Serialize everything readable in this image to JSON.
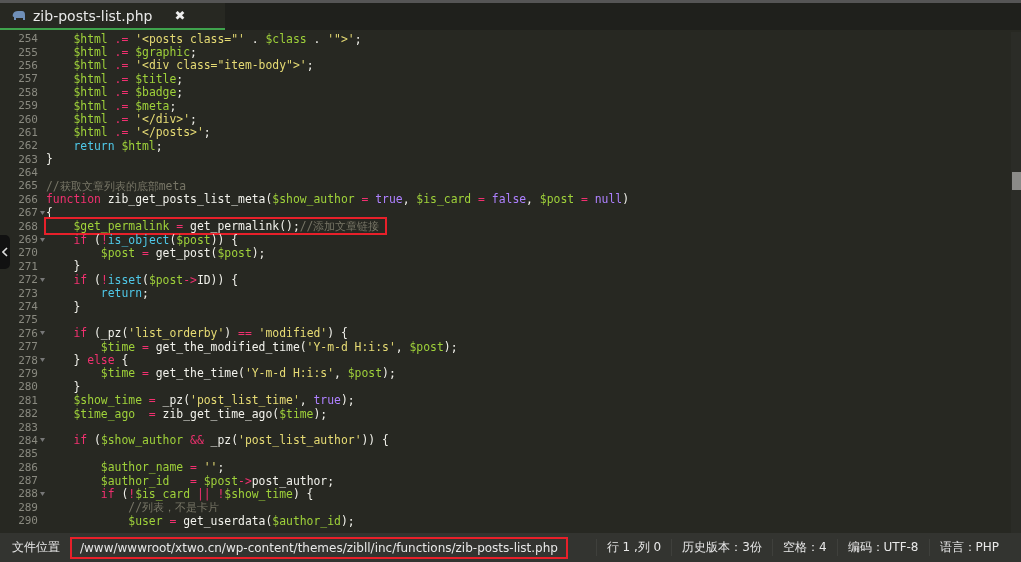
{
  "tabs": [
    {
      "title": "zib-posts-list.php",
      "close": "✖",
      "selected": true
    }
  ],
  "lines": [
    {
      "number": "254",
      "tokens": [
        {
          "kind": "variable",
          "text": "    $html"
        },
        {
          "kind": "operator",
          "text": " .= "
        },
        {
          "kind": "string",
          "text": "'<posts class=\"'"
        },
        {
          "kind": "plain",
          "text": " . "
        },
        {
          "kind": "variable",
          "text": "$class"
        },
        {
          "kind": "plain",
          "text": " . "
        },
        {
          "kind": "string",
          "text": "'\">'"
        },
        {
          "kind": "plain",
          "text": ";"
        }
      ]
    },
    {
      "number": "255",
      "tokens": [
        {
          "kind": "variable",
          "text": "    $html"
        },
        {
          "kind": "operator",
          "text": " .= "
        },
        {
          "kind": "variable",
          "text": "$graphic"
        },
        {
          "kind": "plain",
          "text": ";"
        }
      ]
    },
    {
      "number": "256",
      "tokens": [
        {
          "kind": "variable",
          "text": "    $html"
        },
        {
          "kind": "operator",
          "text": " .= "
        },
        {
          "kind": "string",
          "text": "'<div class=\"item-body\">'"
        },
        {
          "kind": "plain",
          "text": ";"
        }
      ]
    },
    {
      "number": "257",
      "tokens": [
        {
          "kind": "variable",
          "text": "    $html"
        },
        {
          "kind": "operator",
          "text": " .= "
        },
        {
          "kind": "variable",
          "text": "$title"
        },
        {
          "kind": "plain",
          "text": ";"
        }
      ]
    },
    {
      "number": "258",
      "tokens": [
        {
          "kind": "variable",
          "text": "    $html"
        },
        {
          "kind": "operator",
          "text": " .= "
        },
        {
          "kind": "variable",
          "text": "$badge"
        },
        {
          "kind": "plain",
          "text": ";"
        }
      ]
    },
    {
      "number": "259",
      "tokens": [
        {
          "kind": "variable",
          "text": "    $html"
        },
        {
          "kind": "operator",
          "text": " .= "
        },
        {
          "kind": "variable",
          "text": "$meta"
        },
        {
          "kind": "plain",
          "text": ";"
        }
      ]
    },
    {
      "number": "260",
      "tokens": [
        {
          "kind": "variable",
          "text": "    $html"
        },
        {
          "kind": "operator",
          "text": " .= "
        },
        {
          "kind": "string",
          "text": "'</div>'"
        },
        {
          "kind": "plain",
          "text": ";"
        }
      ]
    },
    {
      "number": "261",
      "tokens": [
        {
          "kind": "variable",
          "text": "    $html"
        },
        {
          "kind": "operator",
          "text": " .= "
        },
        {
          "kind": "string",
          "text": "'</posts>'"
        },
        {
          "kind": "plain",
          "text": ";"
        }
      ]
    },
    {
      "number": "262",
      "tokens": [
        {
          "kind": "builtin",
          "text": "    return "
        },
        {
          "kind": "variable",
          "text": "$html"
        },
        {
          "kind": "plain",
          "text": ";"
        }
      ]
    },
    {
      "number": "263",
      "tokens": [
        {
          "kind": "plain",
          "text": "}"
        }
      ]
    },
    {
      "number": "264"
    },
    {
      "number": "265",
      "tokens": [
        {
          "kind": "comment",
          "text": "//获取文章列表的底部meta"
        }
      ]
    },
    {
      "number": "266",
      "tokens": [
        {
          "kind": "keyword",
          "text": "function"
        },
        {
          "kind": "plain",
          "text": " zib_get_posts_list_meta("
        },
        {
          "kind": "variable",
          "text": "$show_author"
        },
        {
          "kind": "operator",
          "text": " = "
        },
        {
          "kind": "constant",
          "text": "true"
        },
        {
          "kind": "plain",
          "text": ", "
        },
        {
          "kind": "variable",
          "text": "$is_card"
        },
        {
          "kind": "operator",
          "text": " = "
        },
        {
          "kind": "constant",
          "text": "false"
        },
        {
          "kind": "plain",
          "text": ", "
        },
        {
          "kind": "variable",
          "text": "$post"
        },
        {
          "kind": "operator",
          "text": " = "
        },
        {
          "kind": "constant",
          "text": "null"
        },
        {
          "kind": "plain",
          "text": ")"
        }
      ]
    },
    {
      "number": "267",
      "foldable": true,
      "tokens": [
        {
          "kind": "plain",
          "text": "{"
        }
      ]
    },
    {
      "number": "268",
      "highlighted": true,
      "tokens": [
        {
          "kind": "variable",
          "text": "    $get_permalink"
        },
        {
          "kind": "operator",
          "text": " = "
        },
        {
          "kind": "plain",
          "text": "get_permalink();"
        },
        {
          "kind": "comment",
          "text": "//添加文章链接"
        }
      ]
    },
    {
      "number": "269",
      "foldable": true,
      "tokens": [
        {
          "kind": "keyword",
          "text": "    if"
        },
        {
          "kind": "plain",
          "text": " ("
        },
        {
          "kind": "operator",
          "text": "!"
        },
        {
          "kind": "builtin",
          "text": "is_object"
        },
        {
          "kind": "plain",
          "text": "("
        },
        {
          "kind": "variable",
          "text": "$post"
        },
        {
          "kind": "plain",
          "text": ")) {"
        }
      ]
    },
    {
      "number": "270",
      "tokens": [
        {
          "kind": "variable",
          "text": "        $post"
        },
        {
          "kind": "operator",
          "text": " = "
        },
        {
          "kind": "plain",
          "text": "get_post("
        },
        {
          "kind": "variable",
          "text": "$post"
        },
        {
          "kind": "plain",
          "text": ");"
        }
      ]
    },
    {
      "number": "271",
      "tokens": [
        {
          "kind": "plain",
          "text": "    }"
        }
      ]
    },
    {
      "number": "272",
      "foldable": true,
      "tokens": [
        {
          "kind": "keyword",
          "text": "    if"
        },
        {
          "kind": "plain",
          "text": " ("
        },
        {
          "kind": "operator",
          "text": "!"
        },
        {
          "kind": "builtin",
          "text": "isset"
        },
        {
          "kind": "plain",
          "text": "("
        },
        {
          "kind": "variable",
          "text": "$post"
        },
        {
          "kind": "operator",
          "text": "->"
        },
        {
          "kind": "plain",
          "text": "ID)) {"
        }
      ]
    },
    {
      "number": "273",
      "tokens": [
        {
          "kind": "builtin",
          "text": "        return"
        },
        {
          "kind": "plain",
          "text": ";"
        }
      ]
    },
    {
      "number": "274",
      "tokens": [
        {
          "kind": "plain",
          "text": "    }"
        }
      ]
    },
    {
      "number": "275"
    },
    {
      "number": "276",
      "foldable": true,
      "tokens": [
        {
          "kind": "keyword",
          "text": "    if"
        },
        {
          "kind": "plain",
          "text": " (_pz("
        },
        {
          "kind": "string",
          "text": "'list_orderby'"
        },
        {
          "kind": "plain",
          "text": ") "
        },
        {
          "kind": "operator",
          "text": "=="
        },
        {
          "kind": "string",
          "text": " 'modified'"
        },
        {
          "kind": "plain",
          "text": ") {"
        }
      ]
    },
    {
      "number": "277",
      "tokens": [
        {
          "kind": "variable",
          "text": "        $time"
        },
        {
          "kind": "operator",
          "text": " = "
        },
        {
          "kind": "plain",
          "text": "get_the_modified_time("
        },
        {
          "kind": "string",
          "text": "'Y-m-d H:i:s'"
        },
        {
          "kind": "plain",
          "text": ", "
        },
        {
          "kind": "variable",
          "text": "$post"
        },
        {
          "kind": "plain",
          "text": ");"
        }
      ]
    },
    {
      "number": "278",
      "foldable": true,
      "tokens": [
        {
          "kind": "plain",
          "text": "    } "
        },
        {
          "kind": "keyword",
          "text": "else"
        },
        {
          "kind": "plain",
          "text": " {"
        }
      ]
    },
    {
      "number": "279",
      "tokens": [
        {
          "kind": "variable",
          "text": "        $time"
        },
        {
          "kind": "operator",
          "text": " = "
        },
        {
          "kind": "plain",
          "text": "get_the_time("
        },
        {
          "kind": "string",
          "text": "'Y-m-d H:i:s'"
        },
        {
          "kind": "plain",
          "text": ", "
        },
        {
          "kind": "variable",
          "text": "$post"
        },
        {
          "kind": "plain",
          "text": ");"
        }
      ]
    },
    {
      "number": "280",
      "tokens": [
        {
          "kind": "plain",
          "text": "    }"
        }
      ]
    },
    {
      "number": "281",
      "tokens": [
        {
          "kind": "variable",
          "text": "    $show_time"
        },
        {
          "kind": "operator",
          "text": " = "
        },
        {
          "kind": "plain",
          "text": "_pz("
        },
        {
          "kind": "string",
          "text": "'post_list_time'"
        },
        {
          "kind": "plain",
          "text": ", "
        },
        {
          "kind": "constant",
          "text": "true"
        },
        {
          "kind": "plain",
          "text": ");"
        }
      ]
    },
    {
      "number": "282",
      "tokens": [
        {
          "kind": "variable",
          "text": "    $time_ago"
        },
        {
          "kind": "operator",
          "text": "  = "
        },
        {
          "kind": "plain",
          "text": "zib_get_time_ago("
        },
        {
          "kind": "variable",
          "text": "$time"
        },
        {
          "kind": "plain",
          "text": ");"
        }
      ]
    },
    {
      "number": "283"
    },
    {
      "number": "284",
      "foldable": true,
      "tokens": [
        {
          "kind": "keyword",
          "text": "    if"
        },
        {
          "kind": "plain",
          "text": " ("
        },
        {
          "kind": "variable",
          "text": "$show_author"
        },
        {
          "kind": "operator",
          "text": " && "
        },
        {
          "kind": "plain",
          "text": "_pz("
        },
        {
          "kind": "string",
          "text": "'post_list_author'"
        },
        {
          "kind": "plain",
          "text": ")) {"
        }
      ]
    },
    {
      "number": "285"
    },
    {
      "number": "286",
      "tokens": [
        {
          "kind": "variable",
          "text": "        $author_name"
        },
        {
          "kind": "operator",
          "text": " = "
        },
        {
          "kind": "string",
          "text": "''"
        },
        {
          "kind": "plain",
          "text": ";"
        }
      ]
    },
    {
      "number": "287",
      "tokens": [
        {
          "kind": "variable",
          "text": "        $author_id"
        },
        {
          "kind": "operator",
          "text": "   = "
        },
        {
          "kind": "variable",
          "text": "$post"
        },
        {
          "kind": "operator",
          "text": "->"
        },
        {
          "kind": "plain",
          "text": "post_author;"
        }
      ]
    },
    {
      "number": "288",
      "foldable": true,
      "tokens": [
        {
          "kind": "keyword",
          "text": "        if"
        },
        {
          "kind": "plain",
          "text": " ("
        },
        {
          "kind": "operator",
          "text": "!"
        },
        {
          "kind": "variable",
          "text": "$is_card"
        },
        {
          "kind": "operator",
          "text": " || !"
        },
        {
          "kind": "variable",
          "text": "$show_time"
        },
        {
          "kind": "plain",
          "text": ") {"
        }
      ]
    },
    {
      "number": "289",
      "tokens": [
        {
          "kind": "comment",
          "text": "            //列表，不是卡片"
        }
      ]
    },
    {
      "number": "290",
      "tokens": [
        {
          "kind": "variable",
          "text": "            $user"
        },
        {
          "kind": "operator",
          "text": " = "
        },
        {
          "kind": "plain",
          "text": "get_userdata("
        },
        {
          "kind": "variable",
          "text": "$author_id"
        },
        {
          "kind": "plain",
          "text": ");"
        }
      ]
    }
  ],
  "status_bar": {
    "label": "文件位置",
    "path": "/www/wwwroot/xtwo.cn/wp-content/themes/zibll/inc/functions/zib-posts-list.php",
    "path_highlighted": true,
    "items": [
      "行 1 ,列 0",
      "历史版本：3份",
      "空格：4",
      "编码：UTF-8",
      "语言：PHP"
    ]
  }
}
